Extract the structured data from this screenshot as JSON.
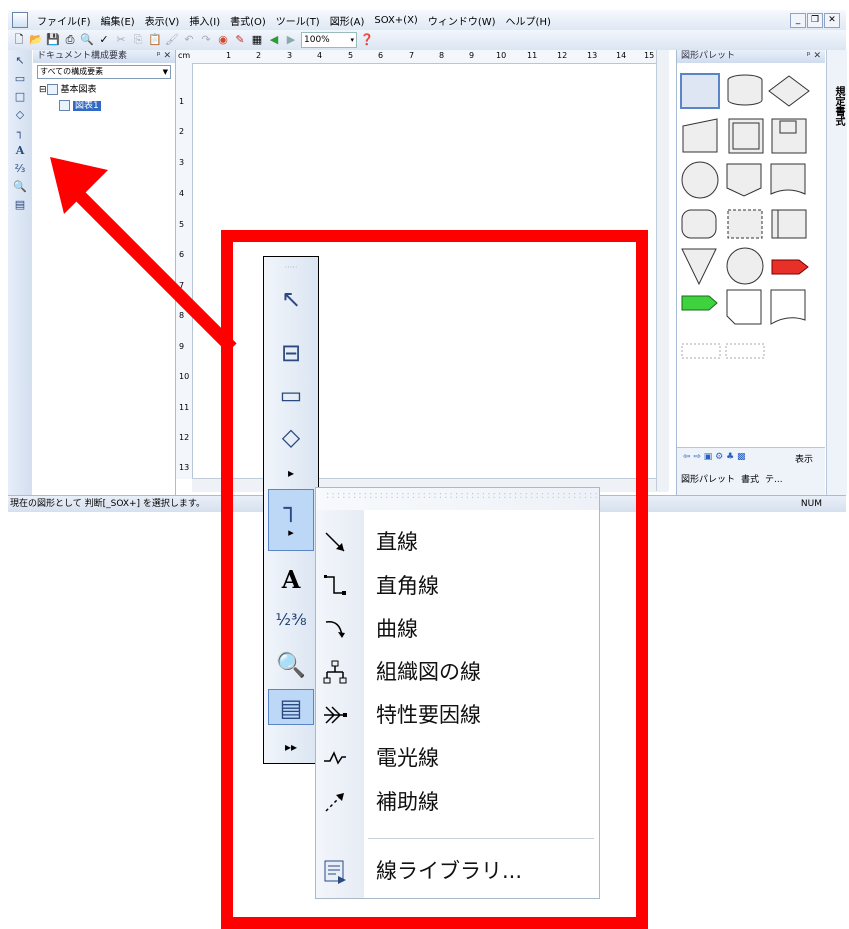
{
  "menubar": {
    "items": [
      "ファイル(F)",
      "編集(E)",
      "表示(V)",
      "挿入(I)",
      "書式(O)",
      "ツール(T)",
      "図形(A)",
      "SOX+(X)",
      "ウィンドウ(W)",
      "ヘルプ(H)"
    ]
  },
  "toolbar": {
    "zoom": "100%"
  },
  "doc_panel": {
    "title": "ドキュメント構成要素",
    "filter": "すべての構成要素",
    "tree_root": "基本図表",
    "tree_child": "図表1"
  },
  "ruler": {
    "unit": "cm",
    "h_ticks": [
      "1",
      "2",
      "3",
      "4",
      "5",
      "6",
      "7",
      "8",
      "9",
      "10",
      "11",
      "12",
      "13",
      "14",
      "15"
    ],
    "v_ticks": [
      "1",
      "2",
      "3",
      "4",
      "5",
      "6",
      "7",
      "8",
      "9",
      "10",
      "11",
      "12",
      "13"
    ]
  },
  "palette": {
    "title": "図形パレット",
    "bottom_show": "表示",
    "tabs": [
      "図形パレット",
      "書式",
      "テ..."
    ],
    "side_tab": "規定書式"
  },
  "statusbar": {
    "message": "現在の図形として 判断[_SOX+] を選択します。",
    "num": "NUM"
  },
  "line_menu": {
    "items": [
      "直線",
      "直角線",
      "曲線",
      "組織図の線",
      "特性要因線",
      "電光線",
      "補助線"
    ],
    "library": "線ライブラリ..."
  },
  "colors": {
    "annotation": "#ff0000",
    "arrow": "#ff0000",
    "selection": "#316ac5"
  }
}
